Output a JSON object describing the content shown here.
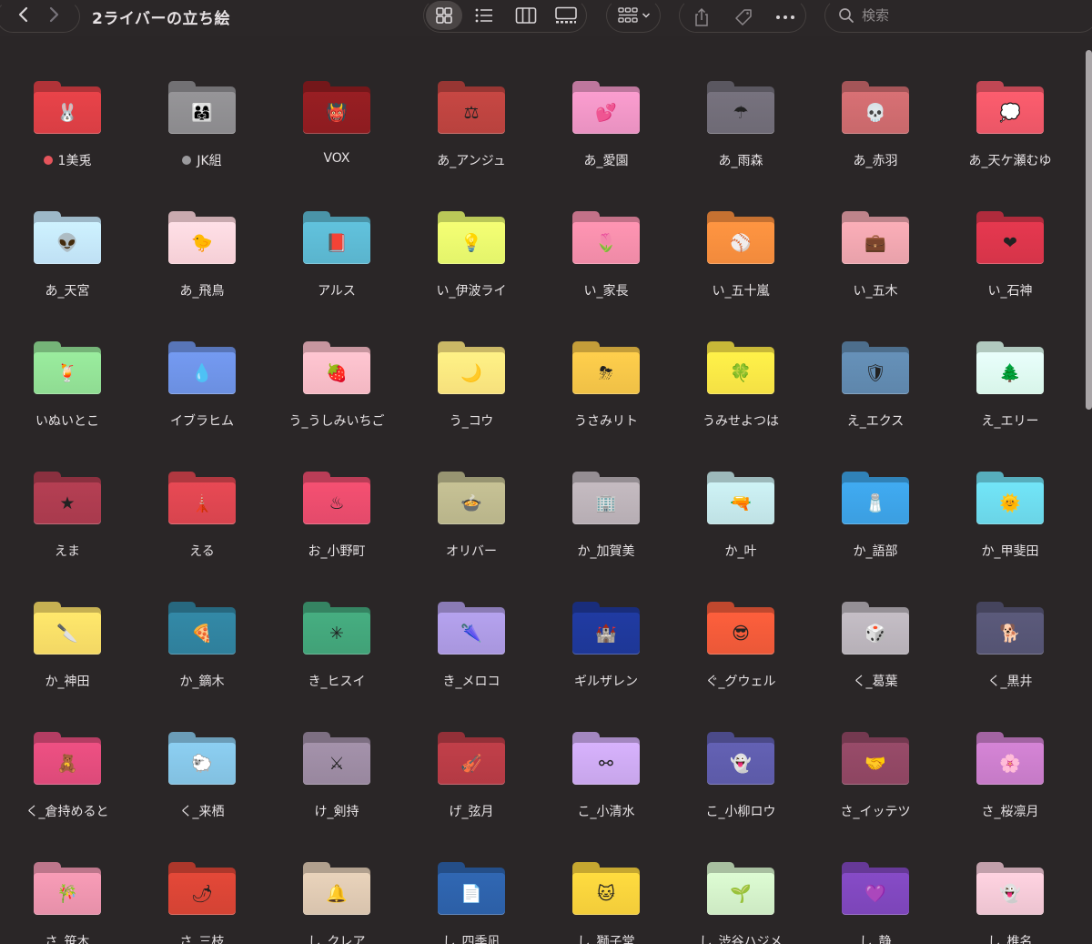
{
  "window": {
    "title": "2ライバーの立ち絵",
    "search_placeholder": "検索"
  },
  "toolbar": {
    "back_icon": "chevron-left-icon",
    "forward_icon": "chevron-right-icon",
    "views": [
      "icon-view",
      "list-view",
      "column-view",
      "gallery-view"
    ],
    "active_view": "icon-view"
  },
  "folders": [
    {
      "name": "1美兎",
      "color": "#d83e44",
      "emoji": "🐰",
      "tag_color": "#e5545b"
    },
    {
      "name": "JK組",
      "color": "#8b8a8d",
      "emoji": "👨‍👩‍👧",
      "tag_color": "#9b9a9d"
    },
    {
      "name": "VOX",
      "color": "#8d1c20",
      "emoji": "👹"
    },
    {
      "name": "あ_アンジュ",
      "color": "#b8423e",
      "emoji": "⚖"
    },
    {
      "name": "あ_愛園",
      "color": "#e891c0",
      "emoji": "💕"
    },
    {
      "name": "あ_雨森",
      "color": "#6e6a75",
      "emoji": "☂"
    },
    {
      "name": "あ_赤羽",
      "color": "#c8686b",
      "emoji": "💀"
    },
    {
      "name": "あ_天ケ瀬むゆ",
      "color": "#ea5666",
      "emoji": "💭"
    },
    {
      "name": "あ_天宮",
      "color": "#bfe0f4",
      "emoji": "👽"
    },
    {
      "name": "あ_飛鳥",
      "color": "#f5cfd6",
      "emoji": "🐤"
    },
    {
      "name": "アルス",
      "color": "#5ab4cd",
      "emoji": "📕"
    },
    {
      "name": "い_伊波ライ",
      "color": "#e3f46b",
      "emoji": "💡"
    },
    {
      "name": "い_家長",
      "color": "#ee8aa6",
      "emoji": "🌷"
    },
    {
      "name": "い_五十嵐",
      "color": "#f18a3c",
      "emoji": "⚾"
    },
    {
      "name": "い_五木",
      "color": "#e8a1aa",
      "emoji": "💼"
    },
    {
      "name": "い_石神",
      "color": "#d53449",
      "emoji": "❤"
    },
    {
      "name": "いぬいとこ",
      "color": "#8fdb92",
      "emoji": "🍹"
    },
    {
      "name": "イブラヒム",
      "color": "#6b8fe0",
      "emoji": "💧"
    },
    {
      "name": "う_うしみいちご",
      "color": "#f3b7c2",
      "emoji": "🍓"
    },
    {
      "name": "う_コウ",
      "color": "#f6e07c",
      "emoji": "🌙"
    },
    {
      "name": "うさみリト",
      "color": "#efc046",
      "emoji": "⛈"
    },
    {
      "name": "うみせよつは",
      "color": "#f4e044",
      "emoji": "🍀"
    },
    {
      "name": "え_エクス",
      "color": "#5e86ab",
      "emoji": "🛡"
    },
    {
      "name": "え_エリー",
      "color": "#d8f5e9",
      "emoji": "🌲"
    },
    {
      "name": "えま",
      "color": "#a83a4d",
      "emoji": "★"
    },
    {
      "name": "える",
      "color": "#d7444e",
      "emoji": "🗼"
    },
    {
      "name": "お_小野町",
      "color": "#e34a6a",
      "emoji": "♨"
    },
    {
      "name": "オリバー",
      "color": "#b8b48a",
      "emoji": "🍲"
    },
    {
      "name": "か_加賀美",
      "color": "#b6adb3",
      "emoji": "🏢"
    },
    {
      "name": "か_叶",
      "color": "#bfe1e4",
      "emoji": "🔫"
    },
    {
      "name": "か_語部",
      "color": "#3b9ee0",
      "emoji": "🧂"
    },
    {
      "name": "か_甲斐田",
      "color": "#6ad4e6",
      "emoji": "🌞"
    },
    {
      "name": "か_神田",
      "color": "#f2d764",
      "emoji": "🔪"
    },
    {
      "name": "か_鏑木",
      "color": "#2f7f9b",
      "emoji": "🍕"
    },
    {
      "name": "き_ヒスイ",
      "color": "#41a177",
      "emoji": "✳"
    },
    {
      "name": "き_メロコ",
      "color": "#a896dd",
      "emoji": "🌂"
    },
    {
      "name": "ギルザレン",
      "color": "#1e3796",
      "emoji": "🏰"
    },
    {
      "name": "ぐ_グウェル",
      "color": "#ea5838",
      "emoji": "😎"
    },
    {
      "name": "く_葛葉",
      "color": "#b6b0b7",
      "emoji": "🎲"
    },
    {
      "name": "く_黒井",
      "color": "#545372",
      "emoji": "🐕"
    },
    {
      "name": "く_倉持めると",
      "color": "#dc4a79",
      "emoji": "🧸"
    },
    {
      "name": "く_来栖",
      "color": "#82c0e0",
      "emoji": "🐑"
    },
    {
      "name": "け_剣持",
      "color": "#98879e",
      "emoji": "⚔"
    },
    {
      "name": "げ_弦月",
      "color": "#b33a44",
      "emoji": "🎻"
    },
    {
      "name": "こ_小清水",
      "color": "#c7a5ea",
      "emoji": "⚯"
    },
    {
      "name": "こ_小柳ロウ",
      "color": "#5c5aa7",
      "emoji": "👻"
    },
    {
      "name": "さ_イッテツ",
      "color": "#8d4561",
      "emoji": "🤝"
    },
    {
      "name": "さ_桜凛月",
      "color": "#c57ac6",
      "emoji": "🌸"
    },
    {
      "name": "さ_笹木",
      "color": "#e690a9",
      "emoji": "🎋"
    },
    {
      "name": "さ_三枝",
      "color": "#d34334",
      "emoji": "🌶"
    },
    {
      "name": "し_クレア",
      "color": "#d8c3ad",
      "emoji": "🔔"
    },
    {
      "name": "し_四季凪",
      "color": "#2c5fa6",
      "emoji": "📄"
    },
    {
      "name": "し_獅子堂",
      "color": "#f2cc3a",
      "emoji": "🐱"
    },
    {
      "name": "し_渋谷ハジメ",
      "color": "#cde9c3",
      "emoji": "🌱"
    },
    {
      "name": "し_静",
      "color": "#7c45b8",
      "emoji": "💜"
    },
    {
      "name": "し_椎名",
      "color": "#ecc3d0",
      "emoji": "👻"
    }
  ]
}
